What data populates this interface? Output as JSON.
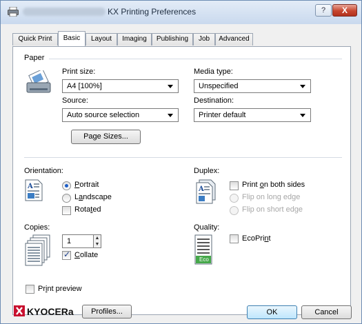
{
  "window": {
    "title": "KX Printing Preferences",
    "help_label": "?",
    "close_label": "X"
  },
  "tabs": [
    "Quick Print",
    "Basic",
    "Layout",
    "Imaging",
    "Publishing",
    "Job",
    "Advanced"
  ],
  "paper": {
    "group_label": "Paper",
    "print_size_label": "Print size:",
    "print_size_value": "A4  [100%]",
    "media_type_label": "Media type:",
    "media_type_value": "Unspecified",
    "source_label": "Source:",
    "source_value": "Auto source selection",
    "destination_label": "Destination:",
    "destination_value": "Printer default",
    "page_sizes_button": "Page Sizes..."
  },
  "orientation": {
    "label": "Orientation:",
    "portrait": "Portrait",
    "landscape": "Landscape",
    "rotated": "Rotated",
    "selected": "Portrait"
  },
  "duplex": {
    "label": "Duplex:",
    "print_both_sides": "Print on both sides",
    "flip_long": "Flip on long edge",
    "flip_short": "Flip on short edge"
  },
  "copies": {
    "label": "Copies:",
    "value": "1",
    "collate": "Collate",
    "collate_checked": true
  },
  "quality": {
    "label": "Quality:",
    "ecoprint": "EcoPrint",
    "eco_badge": "Eco"
  },
  "print_preview": "Print preview",
  "footer": {
    "brand": "KYOCERA",
    "profiles_button": "Profiles...",
    "ok_button": "OK",
    "cancel_button": "Cancel"
  },
  "colors": {
    "accent": "#1d5ec7",
    "brand_red": "#c8102e",
    "close": "#c7462f"
  }
}
